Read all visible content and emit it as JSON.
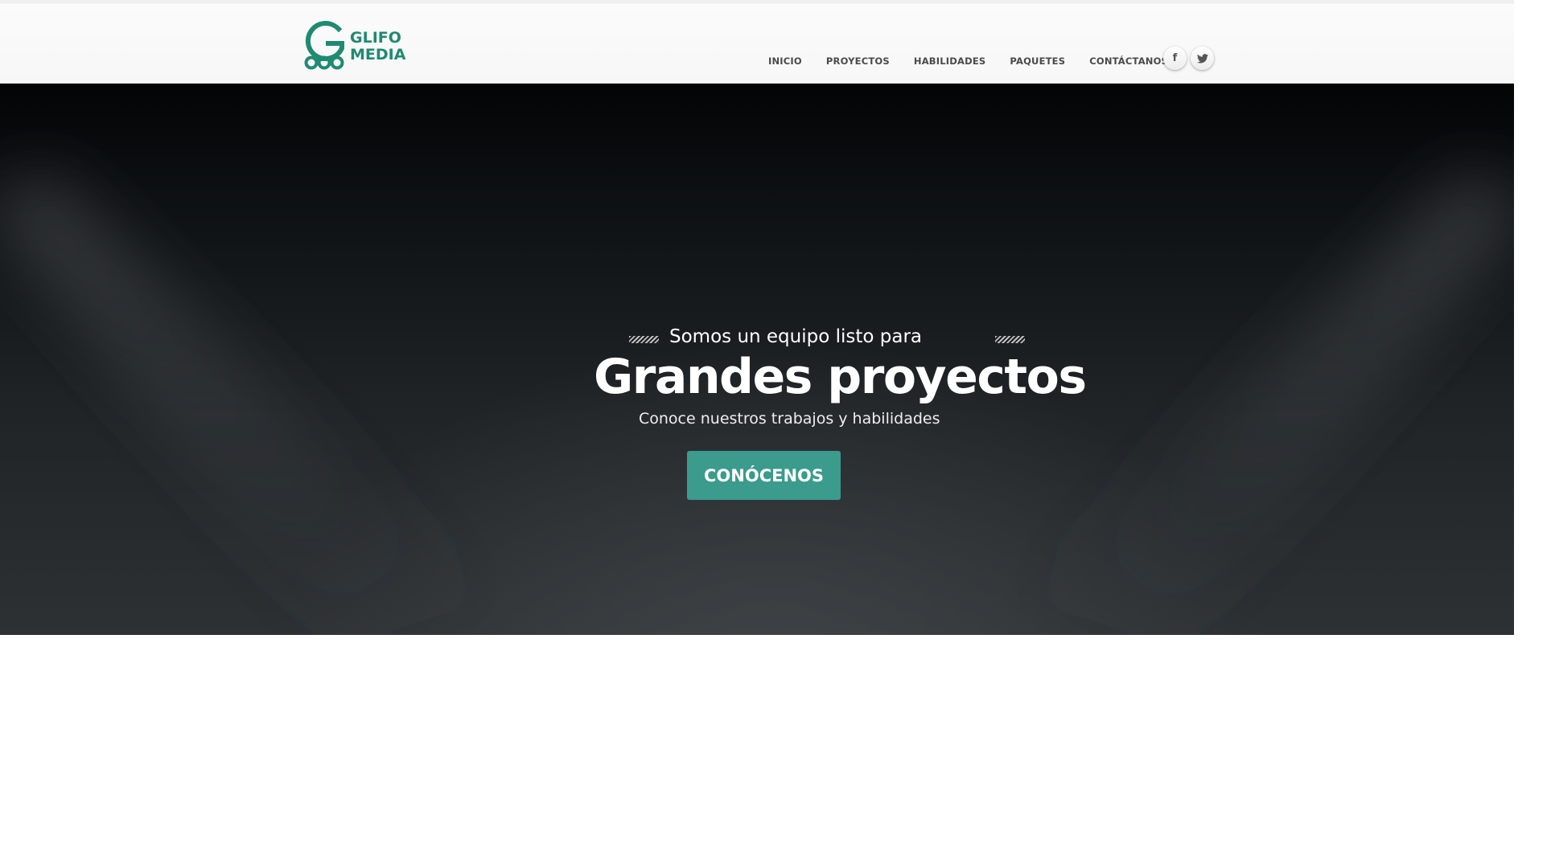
{
  "brand": {
    "logo_line1": "GLIFO",
    "logo_line2": "MEDIA",
    "color": "#1f8a72"
  },
  "nav": {
    "items": [
      {
        "label": "INICIO"
      },
      {
        "label": "PROYECTOS"
      },
      {
        "label": "HABILIDADES"
      },
      {
        "label": "PAQUETES"
      },
      {
        "label": "CONTÁCTANOS"
      }
    ]
  },
  "social": {
    "facebook_glyph": "f",
    "twitter_icon": "twitter-icon",
    "facebook_icon": "facebook-icon"
  },
  "hero": {
    "kicker": "Somos un equipo listo para",
    "headline": "Grandes proyectos",
    "subline": "Conoce nuestros trabajos y habilidades",
    "cta_label": "CONÓCENOS",
    "accent": "#3b9b8c"
  }
}
